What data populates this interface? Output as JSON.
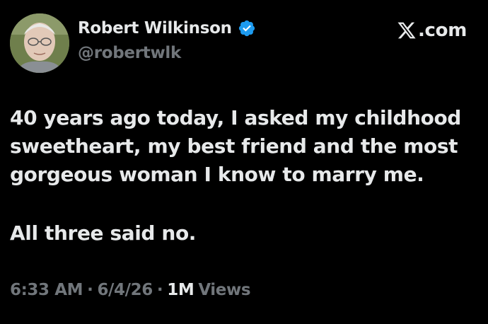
{
  "author": {
    "display_name": "Robert Wilkinson",
    "handle": "@robertwlk",
    "verified": true,
    "verified_color": "#1d9bf0"
  },
  "brand": {
    "label": ".com",
    "icon": "x-logo-icon"
  },
  "tweet": {
    "lines": [
      "40 years ago today, I asked my childhood",
      "sweetheart, my best friend and the most",
      "gorgeous woman I know to marry me."
    ],
    "punchline": "All three said no."
  },
  "meta": {
    "time": "6:33 AM",
    "date": "6/4/26",
    "views_count": "1M",
    "views_label": "Views",
    "separator": "·"
  },
  "colors": {
    "background": "#000000",
    "primary_text": "#e7e9ea",
    "secondary_text": "#71767b"
  }
}
